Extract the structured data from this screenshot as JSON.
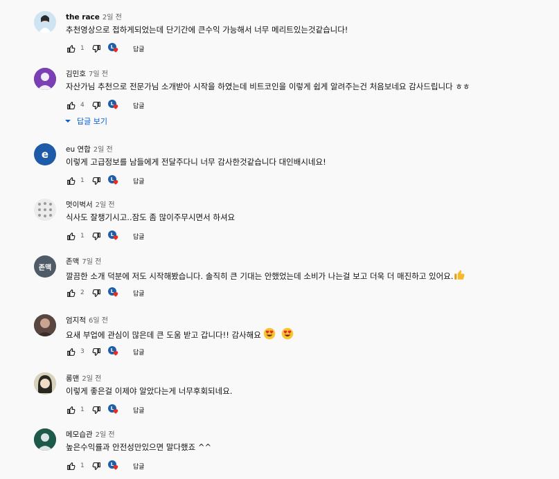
{
  "colors": {
    "link_blue": "#065fd4",
    "text_primary": "#0f0f0f",
    "text_secondary": "#606060",
    "heart_red": "#e52d27",
    "creator_badge": "#1f5fa8"
  },
  "reply_label": "답글",
  "show_replies_label": "답글 보기",
  "comments": [
    {
      "author": "the race",
      "time": "2일 전",
      "text": "추천영상으로 접하게되었는데 단기간에 큰수익 가능해서 너무 메리트있는것같습니다!",
      "likes": "1",
      "avatar_color": "#cfe4f2",
      "avatar_letter": "",
      "bold": true
    },
    {
      "author": "김민호",
      "time": "7일 전",
      "text": "자산가님 추천으로 전문가님 소개받아 시작을 하였는데 비트코인을 이렇게 쉽게 알려주는건 처음보네요 감사드립니다 ㅎㅎ",
      "likes": "4",
      "avatar_color": "#7b3fb5",
      "avatar_letter": "",
      "bold": false
    },
    {
      "author": "eu 연합",
      "time": "2일 전",
      "text": "이렇게 고급정보를 남들에게 전달주다니 너무 감사한것같습니다 대인배시네요!",
      "likes": "1",
      "avatar_color": "#1d5aa8",
      "avatar_letter": "e",
      "bold": false
    },
    {
      "author": "멋이벅서",
      "time": "2일 전",
      "text": "식사도 잘챙기시고..잠도 좀 많이주무시면서 하셔요",
      "likes": "1",
      "avatar_color": "#e6e6e6",
      "avatar_letter": "",
      "bold": false
    },
    {
      "author": "존맥",
      "time": "7일 전",
      "text": "깔끔한 소개 덕분에 저도 시작해봤습니다. 솔직히 큰 기대는 안했었는데 소비가 나는걸 보고 더욱 더 매진하고 있어요.",
      "likes": "2",
      "avatar_color": "#4f5b66",
      "avatar_letter": "존맥",
      "bold": false
    },
    {
      "author": "엄지적",
      "time": "6일 전",
      "text": "요새 부업에 관심이 많은데 큰 도움 받고 갑니다!! 감사해요",
      "likes": "3",
      "avatar_color": "#6b5048",
      "avatar_letter": "",
      "bold": false
    },
    {
      "author": "롱맨",
      "time": "2일 전",
      "text": "이렇게 좋은걸 이제야 알았다는게 너무후회되네요.",
      "likes": "1",
      "avatar_color": "#b9b39b",
      "avatar_letter": "",
      "bold": false
    },
    {
      "author": "메모습관",
      "time": "2일 전",
      "text": "높은수익률과 안전성만있으면 말다했죠 ^^",
      "likes": "1",
      "avatar_color": "#1e5a4a",
      "avatar_letter": "",
      "bold": false
    }
  ]
}
